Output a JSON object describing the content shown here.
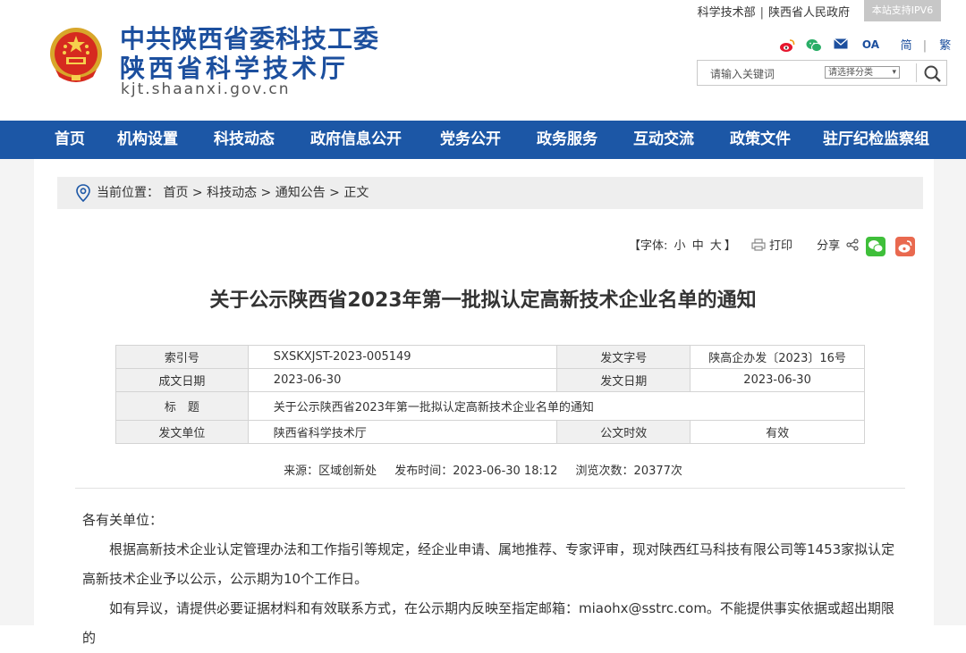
{
  "header": {
    "logo_line1": "中共陕西省委科技工委",
    "logo_line2": "陕西省科学技术厅",
    "domain": "kjt.shaanxi.gov.cn",
    "top_links": [
      "科学技术部",
      "陕西省人民政府"
    ],
    "ipv6_badge": "本站支持IPV6",
    "social_icons": [
      "weibo-icon",
      "wechat-icon",
      "email-icon",
      "oa-icon"
    ],
    "oa_label": "OA",
    "lang_simplified": "简",
    "lang_traditional": "繁",
    "search": {
      "placeholder": "请输入关键词",
      "category": "请选择分类"
    }
  },
  "nav": {
    "items": [
      "首页",
      "机构设置",
      "科技动态",
      "政府信息公开",
      "党务公开",
      "政务服务",
      "互动交流",
      "政策文件",
      "驻厅纪检监察组"
    ]
  },
  "breadcrumb": {
    "label": "当前位置：",
    "path": "首页 > 科技动态 > 通知公告 > 正文"
  },
  "tools": {
    "font_label": "【字体:",
    "font_small": "小",
    "font_medium": "中",
    "font_large": "大",
    "font_end": "】",
    "print": "打印",
    "share": "分享"
  },
  "article": {
    "title": "关于公示陕西省2023年第一批拟认定高新技术企业名单的通知",
    "meta": {
      "index_label": "索引号",
      "index_value": "SXSKXJST-2023-005149",
      "docno_label": "发文字号",
      "docno_value": "陕高企办发〔2023〕16号",
      "created_label": "成文日期",
      "created_value": "2023-06-30",
      "issued_label": "发文日期",
      "issued_value": "2023-06-30",
      "subject_label": "标　题",
      "subject_value": "关于公示陕西省2023年第一批拟认定高新技术企业名单的通知",
      "unit_label": "发文单位",
      "unit_value": "陕西省科学技术厅",
      "validity_label": "公文时效",
      "validity_value": "有效"
    },
    "source": "来源：区域创新处",
    "publish_time": "发布时间：2023-06-30 18:12",
    "views": "浏览次数：20377次",
    "salutation": "各有关单位：",
    "para1": "根据高新技术企业认定管理办法和工作指引等规定，经企业申请、属地推荐、专家评审，现对陕西红马科技有限公司等1453家拟认定高新技术企业予以公示，公示期为10个工作日。",
    "para2": "如有异议，请提供必要证据材料和有效联系方式，在公示期内反映至指定邮箱：miaohx@sstrc.com。不能提供事实依据或超出期限的"
  }
}
